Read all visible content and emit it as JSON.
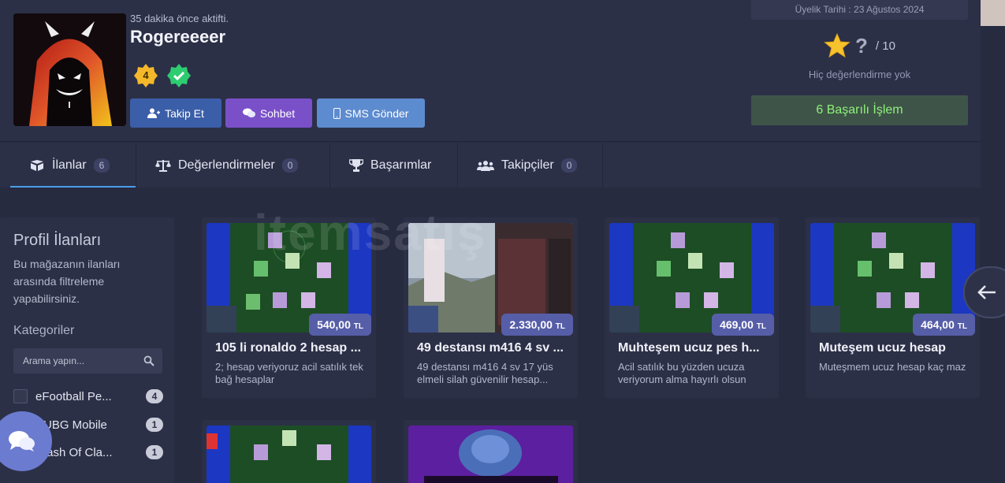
{
  "profile": {
    "last_active": "35 dakika önce aktifti.",
    "username": "Rogereeeer",
    "level": "4",
    "buttons": {
      "follow": "Takip Et",
      "chat": "Sohbet",
      "sms": "SMS Gönder"
    },
    "member_since": "Üyelik Tarihi : 23 Ağustos 2024",
    "rating_value": "?",
    "rating_max": "/ 10",
    "no_rating": "Hiç değerlendirme yok",
    "success": "6 Başarılı İşlem"
  },
  "tabs": [
    {
      "label": "İlanlar",
      "count": "6"
    },
    {
      "label": "Değerlendirmeler",
      "count": "0"
    },
    {
      "label": "Başarımlar"
    },
    {
      "label": "Takipçiler",
      "count": "0"
    }
  ],
  "sidebar": {
    "title": "Profil İlanları",
    "description": "Bu mağazanın ilanları arasında filtreleme yapabilirsiniz.",
    "categories_label": "Kategoriler",
    "search_placeholder": "Arama yapın...",
    "filters": [
      {
        "label": "eFootball Pe...",
        "count": "4"
      },
      {
        "label": "PUBG Mobile",
        "count": "1"
      },
      {
        "label": "Clash Of Cla...",
        "count": "1"
      }
    ]
  },
  "listings": [
    {
      "title": "105 li ronaldo 2 hesap ...",
      "desc": "2; hesap veriyoruz acil satılık tek bağ hesaplar",
      "price": "540,00",
      "currency": "TL"
    },
    {
      "title": "49 destansı m416 4 sv ...",
      "desc": "49 destansı m416 4 sv 17 yüs elmeli silah güvenilir hesap...",
      "price": "2.330,00",
      "currency": "TL"
    },
    {
      "title": "Muhteşem ucuz pes h...",
      "desc": "Acil satılık bu yüzden ucuza veriyorum alma hayırlı olsun",
      "price": "469,00",
      "currency": "TL"
    },
    {
      "title": "Muteşem ucuz hesap",
      "desc": "Muteşmem ucuz hesap kaç maz",
      "price": "464,00",
      "currency": "TL"
    }
  ],
  "watermark": "itemsatış",
  "colors": {
    "accent": "#4a9de9",
    "price_badge": "#565ea8",
    "success_text": "#8df27a"
  }
}
